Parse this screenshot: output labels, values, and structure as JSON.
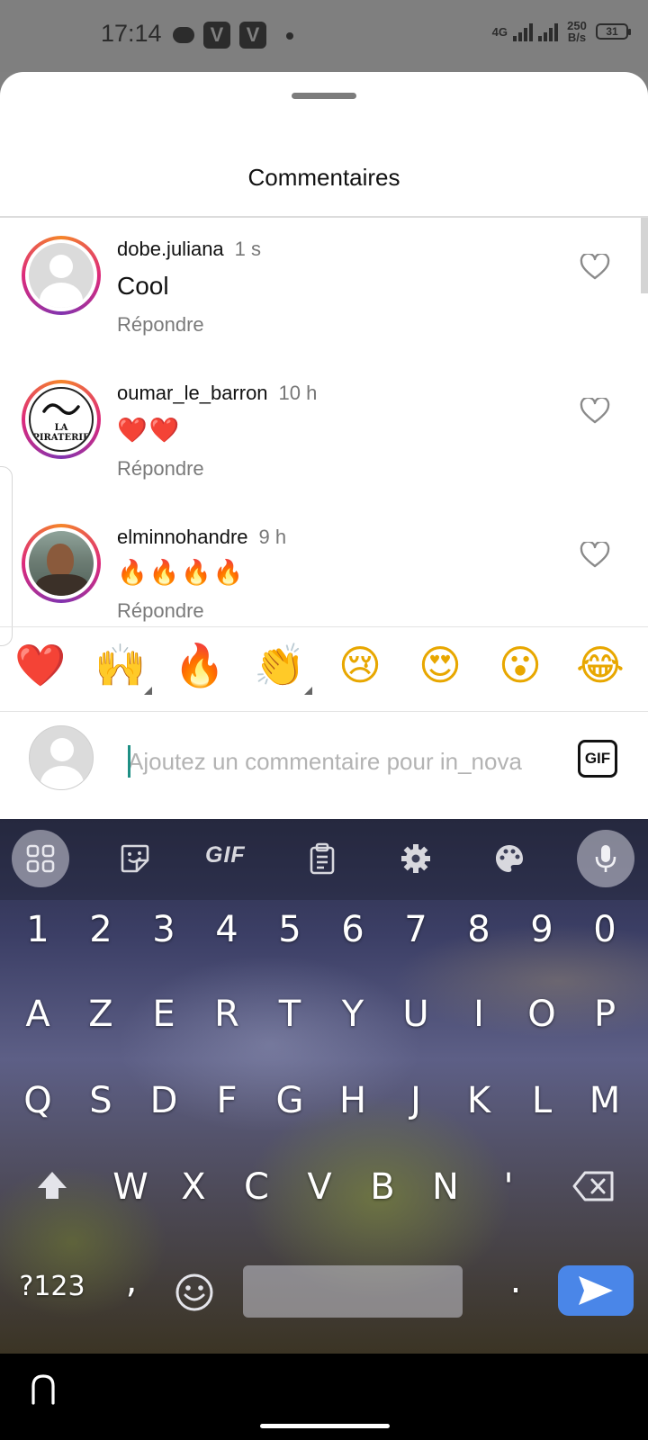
{
  "status_bar": {
    "time": "17:14",
    "network_type": "4G",
    "speed_value": "250",
    "speed_unit": "B/s",
    "battery": "31",
    "icons": [
      "message-icon",
      "v-app-icon",
      "v-app-icon",
      "dot-icon",
      "signal-icon",
      "battery-icon"
    ]
  },
  "sheet": {
    "title": "Commentaires"
  },
  "comments": [
    {
      "username": "dobe.juliana",
      "time": "1 s",
      "text": "Cool",
      "reply_label": "Répondre",
      "avatar": "default-avatar"
    },
    {
      "username": "oumar_le_barron",
      "time": "10 h",
      "text": "❤️❤️",
      "reply_label": "Répondre",
      "avatar": "la-piraterie-logo",
      "avatar_text": "LA PIRATERIE"
    },
    {
      "username": "elminnohandre",
      "time": "9 h",
      "text": "🔥🔥🔥🔥",
      "reply_label": "Répondre",
      "avatar": "photo-avatar"
    }
  ],
  "quick_reactions": [
    "❤️",
    "🙌",
    "🔥",
    "👏",
    "😢",
    "😍",
    "😮",
    "😂"
  ],
  "comment_input": {
    "placeholder": "Ajoutez un commentaire pour in_nova",
    "value": "",
    "gif_label": "GIF"
  },
  "keyboard": {
    "toolbar": {
      "gif_label": "GIF",
      "icons": [
        "apps-grid-icon",
        "sticker-icon",
        "gif-icon",
        "clipboard-icon",
        "settings-icon",
        "palette-icon",
        "microphone-icon"
      ]
    },
    "number_row": [
      "1",
      "2",
      "3",
      "4",
      "5",
      "6",
      "7",
      "8",
      "9",
      "0"
    ],
    "row1": [
      "A",
      "Z",
      "E",
      "R",
      "T",
      "Y",
      "U",
      "I",
      "O",
      "P"
    ],
    "row2": [
      "Q",
      "S",
      "D",
      "F",
      "G",
      "H",
      "J",
      "K",
      "L",
      "M"
    ],
    "row3": [
      "W",
      "X",
      "C",
      "V",
      "B",
      "N",
      "'"
    ],
    "symbols_label": "?123",
    "comma": ",",
    "period": "."
  },
  "colors": {
    "accent_send": "#4a86e8",
    "heart": "#8a8a8a",
    "ring_gradient": [
      "#f58529",
      "#dd2a7b",
      "#8134af"
    ]
  }
}
